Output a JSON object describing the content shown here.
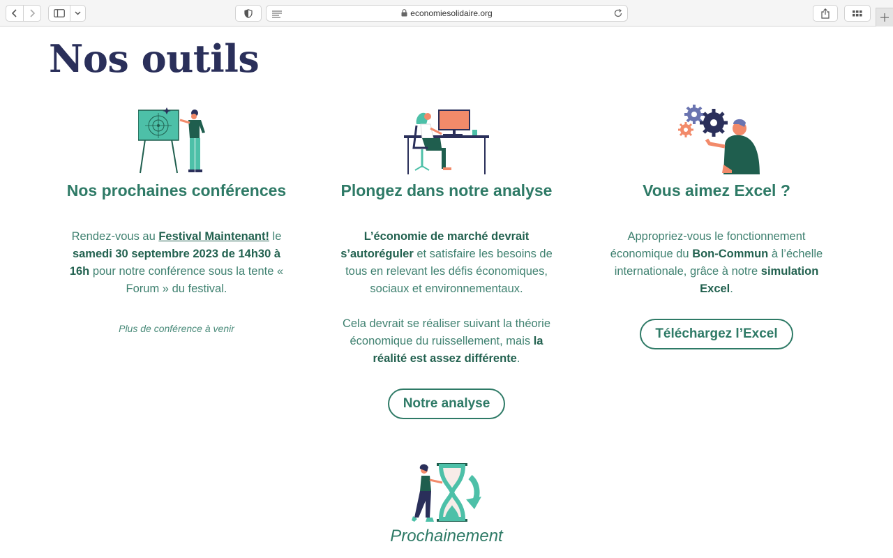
{
  "browser": {
    "url": "economiesolidaire.org"
  },
  "page": {
    "title": "Nos outils",
    "card1": {
      "heading": "Nos prochaines conférences",
      "p1_a": "Rendez-vous au ",
      "p1_link": "Festival Maintenant!",
      "p1_b": " le ",
      "p1_bold": "samedi 30 septembre 2023 de 14h30 à 16h",
      "p1_c": " pour notre conférence sous la tente « Forum » du festival.",
      "note": "Plus de conférence à venir"
    },
    "card2": {
      "heading": "Plongez dans notre analyse",
      "p1_bold": "L’économie de marché devrait s’autoréguler",
      "p1_rest": " et satisfaire les besoins de tous en relevant les défis économiques, sociaux et environnementaux.",
      "p2_a": "Cela devrait se réaliser suivant la théorie économique du ruissellement, mais ",
      "p2_bold": "la réalité est assez différente",
      "p2_end": ".",
      "button": "Notre analyse"
    },
    "card3": {
      "heading": "Vous aimez Excel ?",
      "p1_a": "Appropriez-vous le fonctionnement économique du ",
      "p1_bold1": "Bon-Commun",
      "p1_b": " à l’échelle internationale, grâce à notre ",
      "p1_bold2": "simulation Excel",
      "p1_end": ".",
      "button": "Téléchargez l’Excel"
    },
    "upcoming": {
      "label": "Prochainement"
    }
  },
  "colors": {
    "title": "#2a2f5a",
    "accent": "#2e7a66",
    "teal": "#4dc0a8",
    "orange": "#f28a6a"
  }
}
